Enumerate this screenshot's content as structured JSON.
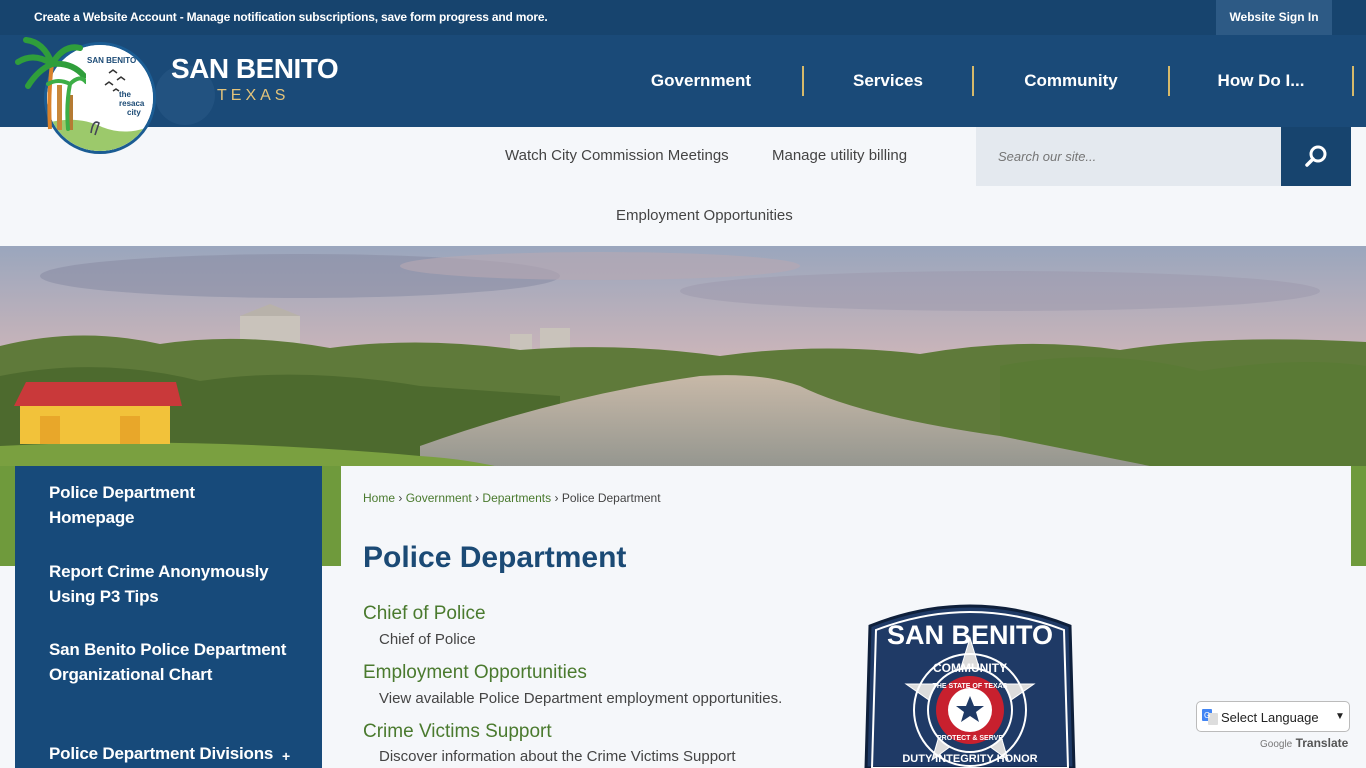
{
  "topbar": {
    "create_text": "Create a Website Account - Manage notification subscriptions, save form progress and more.",
    "signin_label": "Website Sign In"
  },
  "header": {
    "title": "SAN BENITO",
    "subtitle": "TEXAS",
    "logo_text_top": "SAN BENITO",
    "logo_text_lines": [
      "the",
      "resaca",
      "city"
    ]
  },
  "mainnav": [
    {
      "label": "Government"
    },
    {
      "label": "Services"
    },
    {
      "label": "Community"
    },
    {
      "label": "How Do I..."
    }
  ],
  "quicklinks": [
    {
      "label": "Watch City Commission Meetings"
    },
    {
      "label": "Manage utility billing"
    },
    {
      "label": "Employment Opportunities"
    }
  ],
  "search": {
    "placeholder": "Search our site...",
    "icon": "search-icon"
  },
  "sidebar": {
    "items": [
      {
        "label": "Police Department Homepage"
      },
      {
        "label": "Report Crime Anonymously Using P3 Tips"
      },
      {
        "label": "San Benito Police Department Organizational Chart"
      },
      {
        "label": "Police Department Divisions",
        "expand": "+"
      }
    ]
  },
  "breadcrumb": {
    "home": "Home",
    "government": "Government",
    "departments": "Departments",
    "current": "Police Department",
    "separator": "›"
  },
  "content": {
    "title": "Police Department",
    "links": [
      {
        "title": "Chief of Police",
        "desc": "Chief of Police"
      },
      {
        "title": "Employment Opportunities",
        "desc": "View available Police Department employment opportunities."
      },
      {
        "title": "Crime Victims Support",
        "desc": "Discover information about the Crime Victims Support"
      }
    ]
  },
  "badge": {
    "top_text": "SAN BENITO",
    "ring_text": "COMMUNITY",
    "inner_text": "THE STATE OF TEXAS",
    "inner_bottom": "PROTECT & SERVE",
    "bottom_text": "DUTY INTEGRITY HONOR"
  },
  "translate": {
    "label": "Select Language",
    "powered_brand": "Google",
    "powered_label": "Translate"
  },
  "colors": {
    "brand_blue": "#17446e",
    "accent_gold": "#d6b96a",
    "link_green": "#4a7a2e"
  }
}
